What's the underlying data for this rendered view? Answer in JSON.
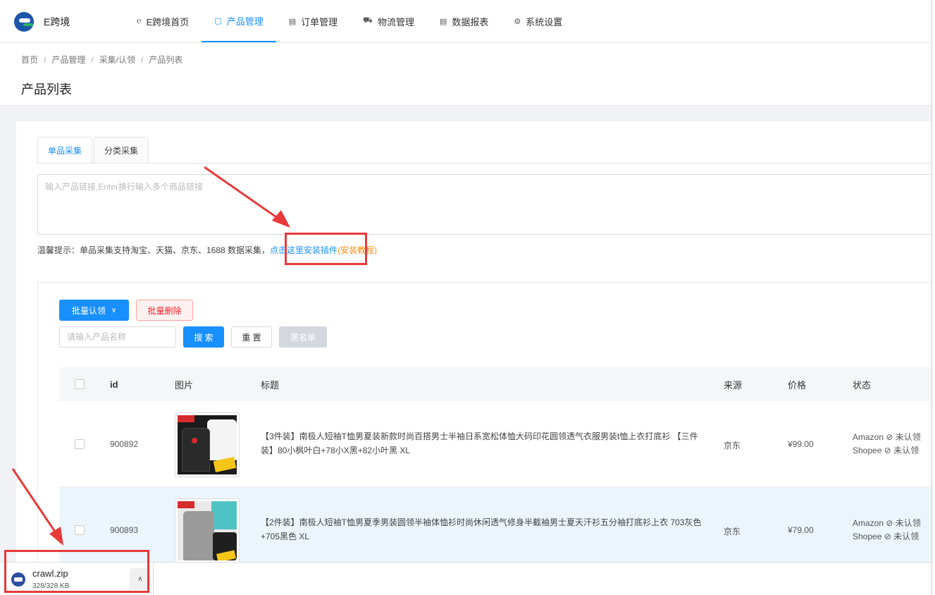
{
  "app": {
    "name": "E跨境"
  },
  "nav": [
    {
      "label": "E跨境首页",
      "icon": "e-icon",
      "glyph": "℮",
      "active": false
    },
    {
      "label": "产品管理",
      "icon": "product-icon",
      "glyph": "▢",
      "active": true
    },
    {
      "label": "订单管理",
      "icon": "order-icon",
      "glyph": "▤",
      "active": false
    },
    {
      "label": "物流管理",
      "icon": "truck-icon",
      "glyph": "⛟",
      "active": false
    },
    {
      "label": "数据报表",
      "icon": "report-icon",
      "glyph": "▤",
      "active": false
    },
    {
      "label": "系统设置",
      "icon": "gear-icon",
      "glyph": "⚙",
      "active": false
    }
  ],
  "breadcrumb": [
    "首页",
    "产品管理",
    "采集/认领",
    "产品列表"
  ],
  "page_title": "产品列表",
  "tabs": [
    {
      "label": "单品采集",
      "active": true
    },
    {
      "label": "分类采集",
      "active": false
    }
  ],
  "url_input": {
    "placeholder": "输入产品链接,Enter换行输入多个商品链接"
  },
  "tip": {
    "text": "温馨提示：单品采集支持淘宝、天猫、京东、1688 数据采集，",
    "link": "点击这里安装插件",
    "tutorial": "(安装教程)"
  },
  "toolbar": {
    "batch_claim": "批量认领",
    "batch_delete": "批量删除",
    "search_placeholder": "请输入产品名称",
    "search": "搜 索",
    "reset": "重 置",
    "blacklist": "黑名单"
  },
  "table": {
    "columns": [
      "id",
      "图片",
      "标题",
      "来源",
      "价格",
      "状态"
    ],
    "rows": [
      {
        "id": "900892",
        "title": "【3件装】南极人短袖T恤男夏装新款时尚百搭男士半袖日系宽松体恤大码印花圆领透气衣服男装t恤上衣打底衫 【三件装】80小枫叶白+78小X黑+82小叶黑 XL",
        "source": "京东",
        "price": "¥99.00",
        "status": [
          "Amazon ⊘ 未认领",
          "Shopee ⊘ 未认领"
        ],
        "highlighted": false
      },
      {
        "id": "900893",
        "title": "【2件装】南极人短袖T恤男夏季男装圆领半袖体恤衫时尚休闲透气修身半截袖男士夏天汗衫五分袖打底衫上衣 703灰色+705黑色 XL",
        "source": "京东",
        "price": "¥79.00",
        "status": [
          "Amazon ⊘ 未认领",
          "Shopee ⊘ 未认领"
        ],
        "highlighted": true
      }
    ]
  },
  "download": {
    "filename": "crawl.zip",
    "size": "328/328 KB"
  },
  "colors": {
    "primary": "#1890ff",
    "danger": "#f5222d",
    "annotation": "#e83a3a",
    "tutorial": "#fa8c16"
  }
}
